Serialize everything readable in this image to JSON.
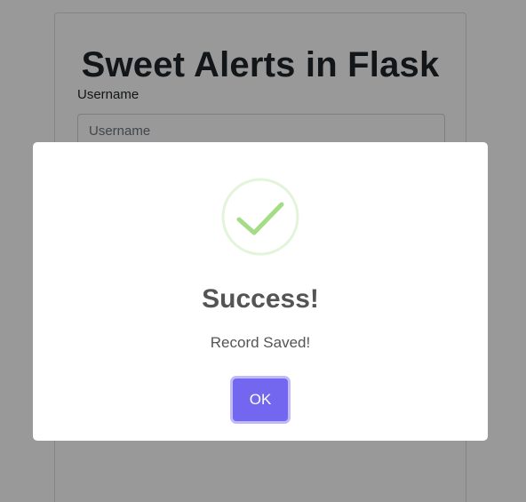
{
  "page": {
    "title": "Sweet Alerts in Flask",
    "username_label": "Username",
    "username_placeholder": "Username",
    "username_value": ""
  },
  "dialog": {
    "icon": "success-check-icon",
    "title": "Success!",
    "text": "Record Saved!",
    "confirm_label": "OK",
    "colors": {
      "accent": "#7367f0",
      "icon": "#a5dc86",
      "text": "#545454",
      "overlay": "rgba(0,0,0,0.4)"
    }
  }
}
